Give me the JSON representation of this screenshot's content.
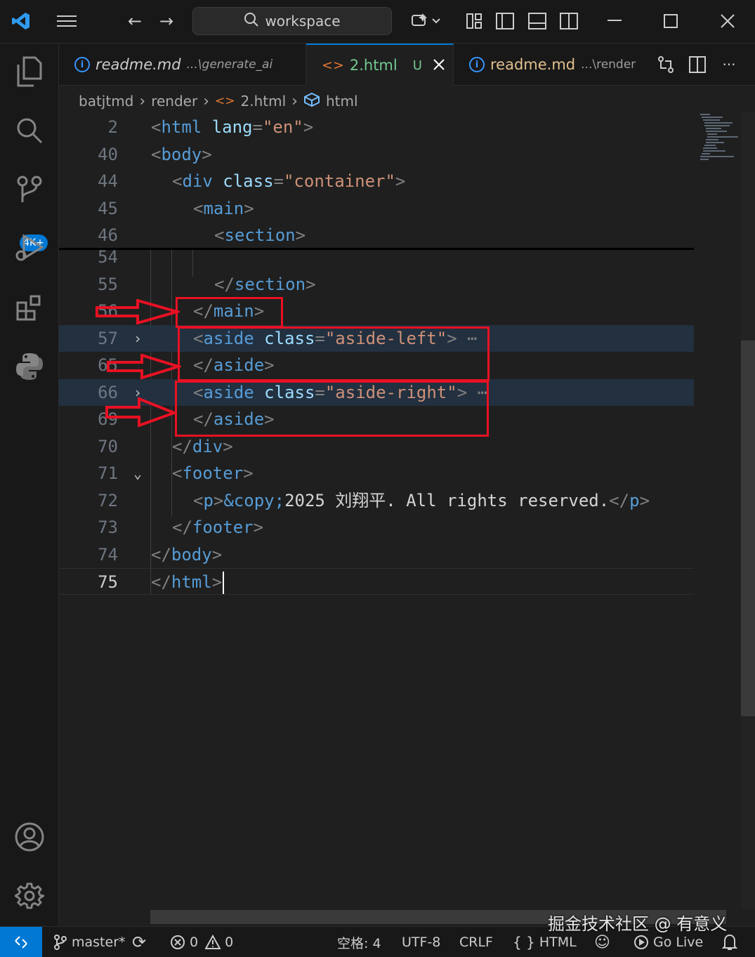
{
  "titlebar": {
    "search_text": "workspace",
    "icons": [
      "vscode-logo-icon",
      "menu-icon",
      "back-arrow-icon",
      "forward-arrow-icon",
      "search-icon",
      "copilot-icon",
      "layout-icon",
      "toggle-primary-sidebar-icon",
      "toggle-panel-icon",
      "toggle-secondary-sidebar-icon",
      "minimize-icon",
      "maximize-icon",
      "close-icon"
    ]
  },
  "activitybar": {
    "items": [
      "explorer-icon",
      "search-icon",
      "source-control-icon",
      "run-debug-icon",
      "extensions-icon",
      "python-icon"
    ],
    "badge": "4K+",
    "bottom": [
      "accounts-icon",
      "manage-gear-icon"
    ]
  },
  "tabs": [
    {
      "label": "readme.md",
      "desc": "...\\generate_ai",
      "italic": true
    },
    {
      "label": "2.html",
      "status": "U",
      "active": true
    },
    {
      "label": "readme.md",
      "desc": "...\\render"
    }
  ],
  "breadcrumb": [
    "batjtmd",
    "render",
    "2.html",
    "html"
  ],
  "editor": {
    "sticky": [
      {
        "num": "2",
        "indent": 0,
        "parts": [
          [
            "br",
            "<"
          ],
          [
            "tag",
            "html"
          ],
          [
            "txt",
            " "
          ],
          [
            "attr",
            "lang"
          ],
          [
            "br",
            "="
          ],
          [
            "str",
            "\"en\""
          ],
          [
            "br",
            ">"
          ]
        ]
      },
      {
        "num": "40",
        "indent": 0,
        "parts": [
          [
            "br",
            "<"
          ],
          [
            "tag",
            "body"
          ],
          [
            "br",
            ">"
          ]
        ]
      },
      {
        "num": "44",
        "indent": 1,
        "parts": [
          [
            "br",
            "<"
          ],
          [
            "tag",
            "div"
          ],
          [
            "txt",
            " "
          ],
          [
            "attr",
            "class"
          ],
          [
            "br",
            "="
          ],
          [
            "str",
            "\"container\""
          ],
          [
            "br",
            ">"
          ]
        ]
      },
      {
        "num": "45",
        "indent": 2,
        "parts": [
          [
            "br",
            "<"
          ],
          [
            "tag",
            "main"
          ],
          [
            "br",
            ">"
          ]
        ]
      },
      {
        "num": "46",
        "indent": 3,
        "parts": [
          [
            "br",
            "<"
          ],
          [
            "tag",
            "section"
          ],
          [
            "br",
            ">"
          ]
        ]
      }
    ],
    "lines": [
      {
        "num": "54",
        "indent": 3,
        "parts": []
      },
      {
        "num": "55",
        "indent": 3,
        "parts": [
          [
            "br",
            "</"
          ],
          [
            "tag",
            "section"
          ],
          [
            "br",
            ">"
          ]
        ]
      },
      {
        "num": "56",
        "indent": 2,
        "parts": [
          [
            "br",
            "</"
          ],
          [
            "tag",
            "main"
          ],
          [
            "br",
            ">"
          ]
        ]
      },
      {
        "num": "57",
        "indent": 2,
        "fold": "›",
        "highlight": true,
        "parts": [
          [
            "br",
            "<"
          ],
          [
            "tag",
            "aside"
          ],
          [
            "txt",
            " "
          ],
          [
            "attr",
            "class"
          ],
          [
            "br",
            "="
          ],
          [
            "str",
            "\"aside-left\""
          ],
          [
            "br",
            ">"
          ],
          [
            "br",
            " ⋯"
          ]
        ]
      },
      {
        "num": "65",
        "indent": 2,
        "parts": [
          [
            "br",
            "</"
          ],
          [
            "tag",
            "aside"
          ],
          [
            "br",
            ">"
          ]
        ]
      },
      {
        "num": "66",
        "indent": 2,
        "fold": "›",
        "highlight": true,
        "parts": [
          [
            "br",
            "<"
          ],
          [
            "tag",
            "aside"
          ],
          [
            "txt",
            " "
          ],
          [
            "attr",
            "class"
          ],
          [
            "br",
            "="
          ],
          [
            "str",
            "\"aside-right\""
          ],
          [
            "br",
            ">"
          ],
          [
            "br",
            " ⋯"
          ]
        ]
      },
      {
        "num": "69",
        "indent": 2,
        "parts": [
          [
            "br",
            "</"
          ],
          [
            "tag",
            "aside"
          ],
          [
            "br",
            ">"
          ]
        ]
      },
      {
        "num": "70",
        "indent": 1,
        "parts": [
          [
            "br",
            "</"
          ],
          [
            "tag",
            "div"
          ],
          [
            "br",
            ">"
          ]
        ]
      },
      {
        "num": "71",
        "indent": 1,
        "fold": "⌄",
        "parts": [
          [
            "br",
            "<"
          ],
          [
            "tag",
            "footer"
          ],
          [
            "br",
            ">"
          ]
        ]
      },
      {
        "num": "72",
        "indent": 2,
        "parts": [
          [
            "br",
            "<"
          ],
          [
            "tag",
            "p"
          ],
          [
            "br",
            ">"
          ],
          [
            "ent",
            "&copy;"
          ],
          [
            "txt",
            "2025 刘翔平. All rights reserved."
          ],
          [
            "br",
            "</"
          ],
          [
            "tag",
            "p"
          ],
          [
            "br",
            ">"
          ]
        ]
      },
      {
        "num": "73",
        "indent": 1,
        "parts": [
          [
            "br",
            "</"
          ],
          [
            "tag",
            "footer"
          ],
          [
            "br",
            ">"
          ]
        ]
      },
      {
        "num": "74",
        "indent": 0,
        "parts": [
          [
            "br",
            "</"
          ],
          [
            "tag",
            "body"
          ],
          [
            "br",
            ">"
          ]
        ]
      },
      {
        "num": "75",
        "indent": 0,
        "current": true,
        "parts": [
          [
            "br",
            "</"
          ],
          [
            "tag",
            "html"
          ],
          [
            "br",
            ">"
          ]
        ]
      }
    ]
  },
  "statusbar": {
    "branch": "master*",
    "errors": "0",
    "warnings": "0",
    "indent": "空格: 4",
    "encoding": "UTF-8",
    "eol": "CRLF",
    "language": "HTML",
    "golive": "Go Live"
  },
  "watermark": "掘金技术社区 @ 有意义",
  "colors": {
    "accent": "#0078d4",
    "annotation": "#e81123",
    "tag": "#569cd6",
    "attr": "#9cdcfe",
    "string": "#ce9178"
  }
}
